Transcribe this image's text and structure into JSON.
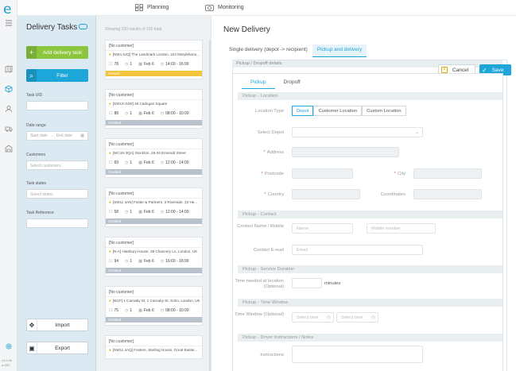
{
  "app": {
    "logo_letter": "e",
    "version_line1": "v1.0.0b",
    "version_line2": "a-001"
  },
  "topnav": {
    "items": [
      {
        "label": "Planning",
        "icon": "planning-icon"
      },
      {
        "label": "Monitoring",
        "icon": "camera-icon"
      }
    ]
  },
  "filters": {
    "title": "Delivery Tasks",
    "add_button": "Add delivery task",
    "filter_button": "Filter",
    "task_uid_label": "Task UID",
    "date_range_label": "Date range",
    "start_date_placeholder": "Start date",
    "end_date_placeholder": "End date",
    "customers_label": "Customers",
    "customers_placeholder": "Select customers",
    "task_states_label": "Task states",
    "task_states_placeholder": "Select states",
    "task_reference_label": "Task Reference",
    "import_button": "Import",
    "export_button": "Export"
  },
  "tasks": {
    "showing": "Showing 100 results of 100 total",
    "items": [
      {
        "customer": "[No customer]",
        "address": "[NW1 6JQ] The Landmark London, 222 Marylebone...",
        "count": "78",
        "units": "1",
        "date": "Feb 6",
        "time": "14:00 - 16:00",
        "status": "Arrived",
        "status_color": "#f2c53d"
      },
      {
        "customer": "[No customer]",
        "address": "[SW1X 0JW] 46 Cadogan Square",
        "count": "88",
        "units": "1",
        "date": "Feb 6",
        "time": "08:00 - 10:00",
        "status": "Created",
        "status_color": "#b8c2cc"
      },
      {
        "customer": "[No customer]",
        "address": "[WC1N 3QA] Stockton, 26-34 Emerald Street",
        "count": "69",
        "units": "1",
        "date": "Feb 6",
        "time": "12:00 - 14:00",
        "status": "Created",
        "status_color": "#b8c2cc"
      },
      {
        "customer": "[No customer]",
        "address": "[SW11 4AN] Foster & Partners, 3 Riverside, 22 He...",
        "count": "58",
        "units": "1",
        "date": "Feb 6",
        "time": "12:00 - 14:00",
        "status": "Created",
        "status_color": "#b8c2cc"
      },
      {
        "customer": "[No customer]",
        "address": "[N-A] Hatsbury House, 38 Chancery Ln, London, UK",
        "count": "94",
        "units": "1",
        "date": "Feb 6",
        "time": "16:00 - 18:00",
        "status": "Created",
        "status_color": "#b8c2cc"
      },
      {
        "customer": "[No customer]",
        "address": "[W1F] 1 Carnaby St, 1 Carnaby St, Soho, London, UK",
        "count": "75",
        "units": "1",
        "date": "Feb 6",
        "time": "08:00 - 10:00",
        "status": "Created",
        "status_color": "#b8c2cc"
      },
      {
        "customer": "[No customer]",
        "address": "[SW11 4AQ] Fosters, Sterling House, Great Easter...",
        "count": "",
        "units": "",
        "date": "",
        "time": "",
        "status": "",
        "status_color": "#b8c2cc"
      }
    ]
  },
  "main": {
    "title": "New Delivery",
    "tabs": [
      "Single delivery (depot -> recipient)",
      "Pickup and delivery"
    ],
    "active_tab": 1,
    "section_title": "Pickup / Dropoff details",
    "cancel": "Cancel",
    "save": "Save",
    "inner_tabs": [
      "Pickup",
      "Dropoff"
    ],
    "location_header": "Pickup - Location",
    "location_type_label": "Location Type",
    "location_types": [
      "Depot",
      "Customer Location",
      "Custom Location"
    ],
    "select_depot_label": "Select Depot",
    "address_label": "Address",
    "postcode_label": "Postcode",
    "city_label": "City",
    "country_label": "Country",
    "coordinates_label": "Coordinates",
    "contact_header": "Pickup - Contact",
    "contact_name_label": "Contact Name / Mobile",
    "name_placeholder": "Name",
    "mobile_placeholder": "Mobile number",
    "contact_email_label": "Contact E-mail",
    "email_placeholder": "Email",
    "service_header": "Pickup - Service Duration",
    "time_needed_label": "Time needed at location (Optional)",
    "minutes_label": "minutes",
    "window_header": "Pickup - Time Window",
    "time_window_label": "Time Window (Optional)",
    "select_time_placeholder": "Select time",
    "notes_header": "Pickup - Driver Instructions / Notes",
    "instructions_label": "Instructions"
  },
  "colors": {
    "accent": "#1ca6d9",
    "add_green": "#8cc63f",
    "filter_panel": "#dbe9f2"
  }
}
